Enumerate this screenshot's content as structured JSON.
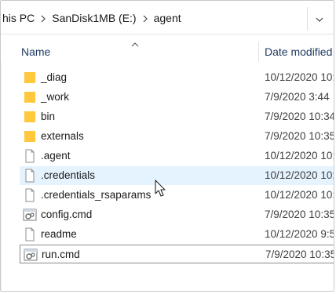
{
  "breadcrumb": {
    "items": [
      "his PC",
      "SanDisk1MB (E:)",
      "agent"
    ]
  },
  "columns": {
    "name": "Name",
    "date_modified": "Date modified"
  },
  "files": [
    {
      "name": "_diag",
      "date": "10/12/2020 10:",
      "icon": "folder-icon"
    },
    {
      "name": "_work",
      "date": "7/9/2020 3:44",
      "icon": "folder-icon"
    },
    {
      "name": "bin",
      "date": "7/9/2020 10:34",
      "icon": "folder-icon"
    },
    {
      "name": "externals",
      "date": "7/9/2020 10:35",
      "icon": "folder-icon"
    },
    {
      "name": ".agent",
      "date": "10/12/2020 10:",
      "icon": "file-icon"
    },
    {
      "name": ".credentials",
      "date": "10/12/2020 10:",
      "icon": "file-icon"
    },
    {
      "name": ".credentials_rsaparams",
      "date": "10/12/2020 10:",
      "icon": "file-icon"
    },
    {
      "name": "config.cmd",
      "date": "7/9/2020 10:35",
      "icon": "cmd-icon"
    },
    {
      "name": "readme",
      "date": "10/12/2020 9:5",
      "icon": "file-icon"
    },
    {
      "name": "run.cmd",
      "date": "7/9/2020 10:35",
      "icon": "cmd-icon"
    }
  ],
  "colors": {
    "folder": "#ffc83d",
    "hover_row": "#e5f3ff",
    "header_text": "#1f3b63"
  }
}
